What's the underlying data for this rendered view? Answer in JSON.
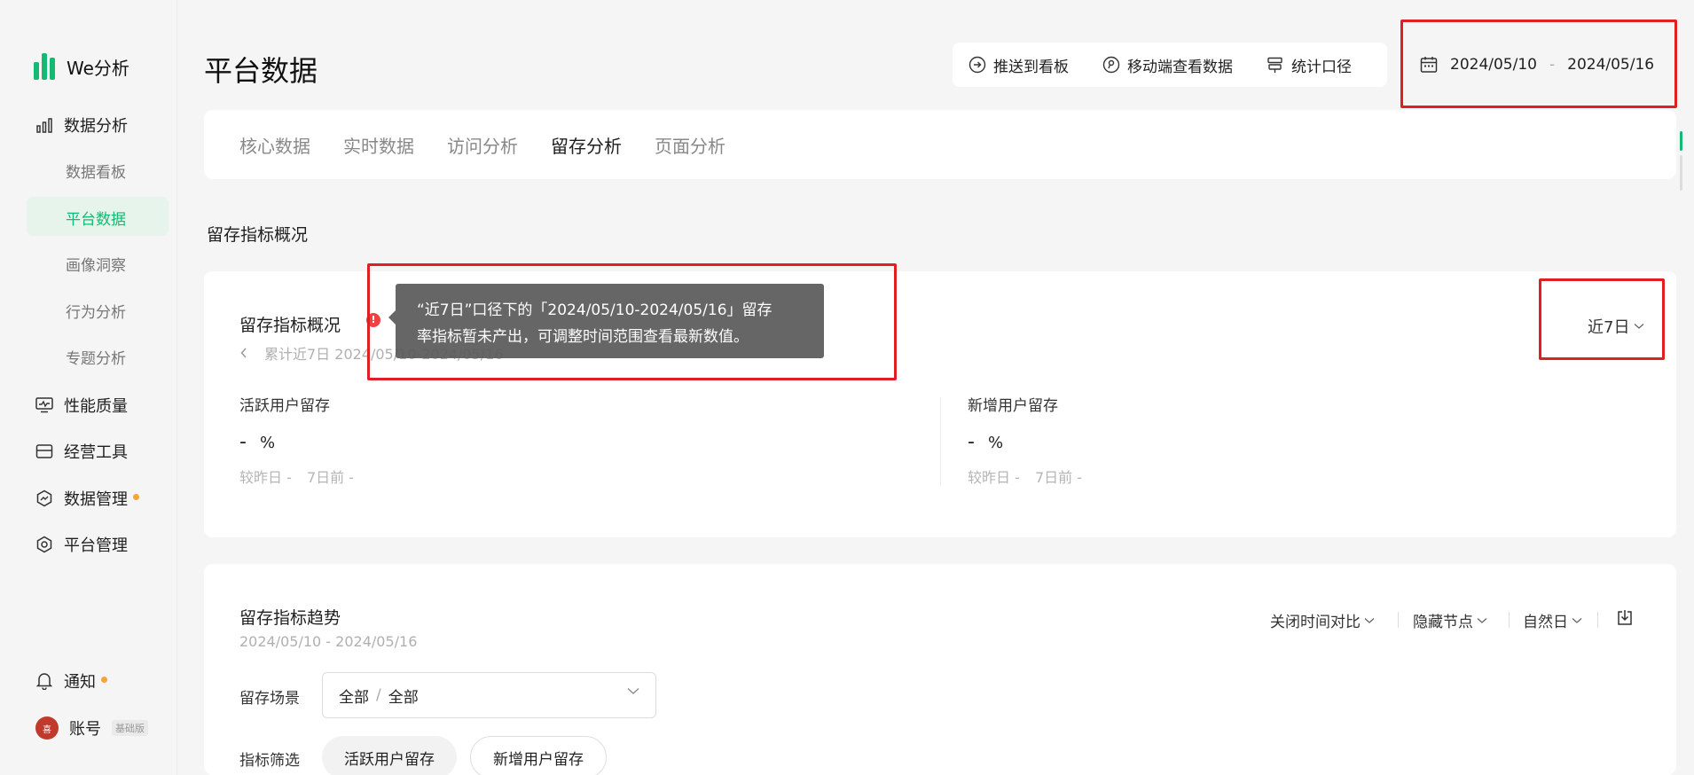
{
  "sidebar": {
    "logo": "We分析",
    "data_analysis": "数据分析",
    "sub_items": {
      "dashboard": "数据看板",
      "platform": "平台数据",
      "portrait": "画像洞察",
      "behavior": "行为分析",
      "topic": "专题分析"
    },
    "performance": "性能质量",
    "operations": "经营工具",
    "data_management": "数据管理",
    "platform_management": "平台管理",
    "notifications": "通知",
    "account": "账号",
    "account_tag": "基础版"
  },
  "header": {
    "title": "平台数据",
    "push_dashboard": "推送到看板",
    "mobile_view": "移动端查看数据",
    "stat_scope": "统计口径",
    "date_start": "2024/05/10",
    "date_sep": "-",
    "date_end": "2024/05/16"
  },
  "tabs": [
    "核心数据",
    "实时数据",
    "访问分析",
    "留存分析",
    "页面分析"
  ],
  "active_tab": "留存分析",
  "overview": {
    "section_title": "留存指标概况",
    "card_title": "留存指标概况",
    "date_range": "累计近7日 2024/05/10-2024/05/16",
    "range_select": "近7日",
    "tooltip_line1": "“近7日”口径下的「2024/05/10-2024/05/16」留存",
    "tooltip_line2": "率指标暂未产出，可调整时间范围查看最新数值。",
    "active_users": {
      "label": "活跃用户留存",
      "value": "-",
      "unit": "%",
      "vs_yesterday": "较昨日 -",
      "vs_7days": "7日前 -"
    },
    "new_users": {
      "label": "新增用户留存",
      "value": "-",
      "unit": "%",
      "vs_yesterday": "较昨日 -",
      "vs_7days": "7日前 -"
    }
  },
  "trend": {
    "title": "留存指标趋势",
    "date_range": "2024/05/10 - 2024/05/16",
    "close_compare": "关闭时间对比",
    "hide_nodes": "隐藏节点",
    "natural_day": "自然日",
    "scene_label": "留存场景",
    "scene_value_a": "全部",
    "scene_value_sep": "/",
    "scene_value_b": "全部",
    "filter_label": "指标筛选",
    "chip_active": "活跃用户留存",
    "chip_new": "新增用户留存"
  },
  "colors": {
    "brand": "#15ba72",
    "highlight_frame": "#e01f25",
    "warning": "#f04142",
    "badge_dot": "#f5a33b"
  }
}
